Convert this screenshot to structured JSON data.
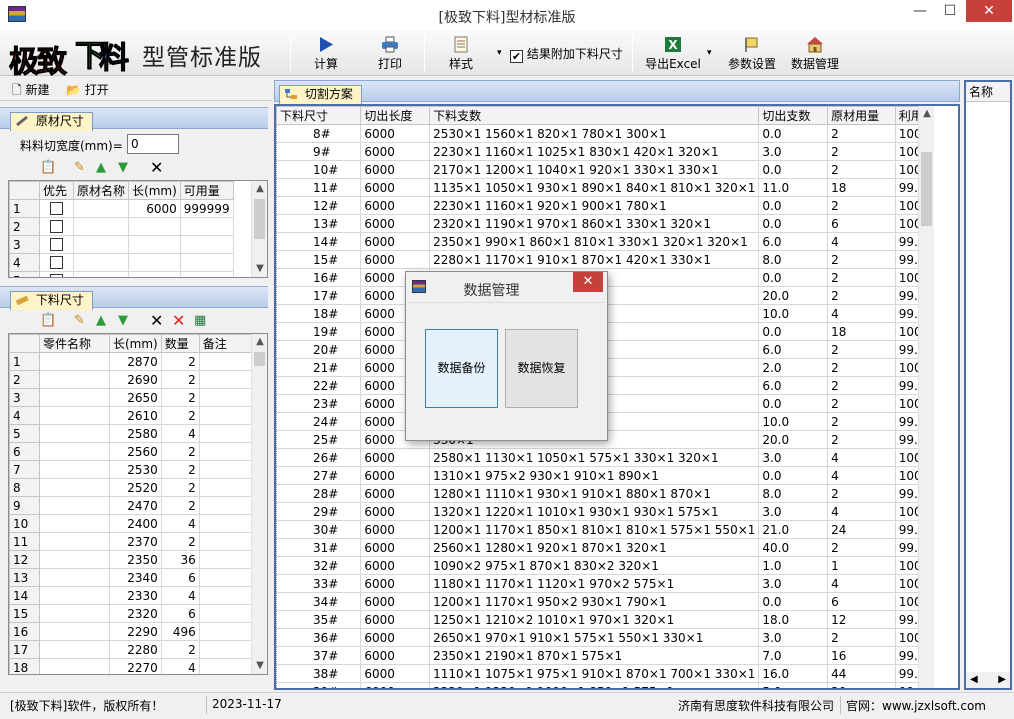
{
  "window": {
    "title": "[极致下料]型材标准版",
    "min_glyph": "—",
    "max_glyph": "☐",
    "close_glyph": "✕"
  },
  "toolbar": {
    "logo": {
      "c1": "极致",
      "c2": "下",
      "c3": "料"
    },
    "subtitle": "型管标准版",
    "calc_label": "计算",
    "print_label": "打印",
    "style_label": "样式",
    "append_label": "结果附加下料尺寸",
    "append_checked": "✔",
    "export_label": "导出Excel",
    "settings_label": "参数设置",
    "data_label": "数据管理",
    "dropdown_glyph": "▾"
  },
  "file_menu": {
    "new_label": "新建",
    "open_label": "打开"
  },
  "raw_panel": {
    "tab_label": "原材尺寸",
    "kerf_label": "料料切宽度(mm)=",
    "kerf_value": "0",
    "columns": [
      "",
      "优先",
      "原材名称",
      "长(mm)",
      "可用量"
    ],
    "rows": [
      {
        "n": "1",
        "len": "6000",
        "qty": "999999"
      },
      {
        "n": "2",
        "len": "",
        "qty": ""
      },
      {
        "n": "3",
        "len": "",
        "qty": ""
      },
      {
        "n": "4",
        "len": "",
        "qty": ""
      },
      {
        "n": "5",
        "len": "",
        "qty": ""
      }
    ]
  },
  "cut_panel": {
    "tab_label": "下料尺寸",
    "columns": [
      "",
      "零件名称",
      "长(mm)",
      "数量",
      "备注"
    ],
    "rows": [
      [
        "1",
        "",
        "2870",
        "2",
        ""
      ],
      [
        "2",
        "",
        "2690",
        "2",
        ""
      ],
      [
        "3",
        "",
        "2650",
        "2",
        ""
      ],
      [
        "4",
        "",
        "2610",
        "2",
        ""
      ],
      [
        "5",
        "",
        "2580",
        "4",
        ""
      ],
      [
        "6",
        "",
        "2560",
        "2",
        ""
      ],
      [
        "7",
        "",
        "2530",
        "2",
        ""
      ],
      [
        "8",
        "",
        "2520",
        "2",
        ""
      ],
      [
        "9",
        "",
        "2470",
        "2",
        ""
      ],
      [
        "10",
        "",
        "2400",
        "4",
        ""
      ],
      [
        "11",
        "",
        "2370",
        "2",
        ""
      ],
      [
        "12",
        "",
        "2350",
        "36",
        ""
      ],
      [
        "13",
        "",
        "2340",
        "6",
        ""
      ],
      [
        "14",
        "",
        "2330",
        "4",
        ""
      ],
      [
        "15",
        "",
        "2320",
        "6",
        ""
      ],
      [
        "16",
        "",
        "2290",
        "496",
        ""
      ],
      [
        "17",
        "",
        "2280",
        "2",
        ""
      ],
      [
        "18",
        "",
        "2270",
        "4",
        ""
      ]
    ]
  },
  "plan": {
    "tab_label": "切割方案",
    "columns": [
      "下料尺寸",
      "切出长度",
      "下料支数",
      "切出支数",
      "原材用量",
      "利用率"
    ],
    "rows": [
      [
        "8#",
        "6000",
        "2530×1 1560×1 820×1 780×1 300×1",
        "0.0",
        "2",
        "100.0%"
      ],
      [
        "9#",
        "6000",
        "2230×1 1160×1 1025×1 830×1 420×1 320×1",
        "3.0",
        "2",
        "100.0%"
      ],
      [
        "10#",
        "6000",
        "2170×1 1200×1 1040×1 920×1 330×1 330×1",
        "0.0",
        "2",
        "100.0%"
      ],
      [
        "11#",
        "6000",
        "1135×1 1050×1 930×1 890×1 840×1 810×1 320×1",
        "11.0",
        "18",
        "99.8%"
      ],
      [
        "12#",
        "6000",
        "2230×1 1160×1 920×1 900×1 780×1",
        "0.0",
        "2",
        "100.0%"
      ],
      [
        "13#",
        "6000",
        "2320×1 1190×1 970×1 860×1 330×1 320×1",
        "0.0",
        "6",
        "100.0%"
      ],
      [
        "14#",
        "6000",
        "2350×1 990×1 860×1 810×1 330×1 320×1 320×1",
        "6.0",
        "4",
        "99.9%"
      ],
      [
        "15#",
        "6000",
        "2280×1 1170×1 910×1 870×1 420×1 330×1",
        "8.0",
        "2",
        "99.9%"
      ],
      [
        "16#",
        "6000",
        "20×1",
        "0.0",
        "2",
        "100.0%"
      ],
      [
        "17#",
        "6000",
        "0×1",
        "20.0",
        "2",
        "99.7%"
      ],
      [
        "18#",
        "6000",
        "0×1",
        "10.0",
        "4",
        "99.8%"
      ],
      [
        "19#",
        "6000",
        "0×1 330×1",
        "0.0",
        "18",
        "100.0%"
      ],
      [
        "20#",
        "6000",
        "75×1 550×1 420×1",
        "6.0",
        "2",
        "99.9%"
      ],
      [
        "21#",
        "6000",
        "20×1 330×1 330×1",
        "2.0",
        "2",
        "100.0%"
      ],
      [
        "22#",
        "6000",
        "0×1 320×2",
        "6.0",
        "2",
        "99.9%"
      ],
      [
        "23#",
        "6000",
        "",
        "0.0",
        "2",
        "100.0%"
      ],
      [
        "24#",
        "6000",
        "20×1",
        "10.0",
        "2",
        "99.8%"
      ],
      [
        "25#",
        "6000",
        "330×1",
        "20.0",
        "2",
        "99.7%"
      ],
      [
        "26#",
        "6000",
        "2580×1 1130×1 1050×1 575×1 330×1 320×1",
        "3.0",
        "4",
        "100.0%"
      ],
      [
        "27#",
        "6000",
        "1310×1 975×2 930×1 910×1 890×1",
        "0.0",
        "4",
        "100.0%"
      ],
      [
        "28#",
        "6000",
        "1280×1 1110×1 930×1 910×1 880×1 870×1",
        "8.0",
        "2",
        "99.9%"
      ],
      [
        "29#",
        "6000",
        "1320×1 1220×1 1010×1 930×1 930×1 575×1",
        "3.0",
        "4",
        "100.0%"
      ],
      [
        "30#",
        "6000",
        "1200×1 1170×1 850×1 810×1 810×1 575×1 550×1",
        "21.0",
        "24",
        "99.7%"
      ],
      [
        "31#",
        "6000",
        "2560×1 1280×1 920×1 870×1 320×1",
        "40.0",
        "2",
        "99.3%"
      ],
      [
        "32#",
        "6000",
        "1090×2 975×1 870×1 830×2 320×1",
        "1.0",
        "1",
        "100.0%"
      ],
      [
        "33#",
        "6000",
        "1180×1 1170×1 1120×1 970×2 575×1",
        "3.0",
        "4",
        "100.0%"
      ],
      [
        "34#",
        "6000",
        "1200×1 1170×1 950×2 930×1 790×1",
        "0.0",
        "6",
        "100.0%"
      ],
      [
        "35#",
        "6000",
        "1250×1 1210×2 1010×1 970×1 320×1",
        "18.0",
        "12",
        "99.7%"
      ],
      [
        "36#",
        "6000",
        "2650×1 970×1 910×1 575×1 550×1 330×1",
        "3.0",
        "2",
        "100.0%"
      ],
      [
        "37#",
        "6000",
        "2350×1 2190×1 870×1 575×1",
        "7.0",
        "16",
        "99.9%"
      ],
      [
        "38#",
        "6000",
        "1110×1 1075×1 975×1 910×1 870×1 700×1 330×1",
        "16.0",
        "44",
        "99.7%"
      ],
      [
        "39#",
        "6000",
        "2220×1 1220×1 1090×1 850×1 575×1",
        "5.0",
        "20",
        "99.9%"
      ]
    ]
  },
  "right_pane": {
    "header": "名称"
  },
  "dialog": {
    "title": "数据管理",
    "backup_label": "数据备份",
    "restore_label": "数据恢复",
    "close_glyph": "✕"
  },
  "status": {
    "copyright": "[极致下料]软件，版权所有！",
    "date": "2023-11-17",
    "company": "济南有思度软件科技有限公司",
    "website": "官网：www.jzxlsoft.com"
  },
  "colors": {
    "accent": "#4a6fa8",
    "close_red": "#c7413c",
    "tab_yellow": "#fff3c8"
  }
}
